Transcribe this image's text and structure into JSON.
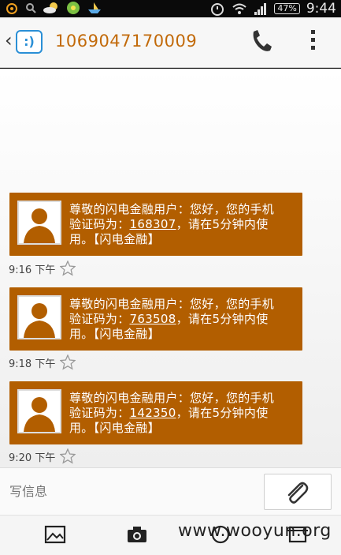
{
  "status_bar": {
    "battery": "47%",
    "time": "9:44"
  },
  "header": {
    "title": "1069047170009"
  },
  "messages": [
    {
      "line1": "尊敬的闪电金融用户：您好，您的手机",
      "line2_prefix": "验证码为：",
      "code": "168307",
      "line2_suffix": "，请在5分钟内使",
      "line3": "用。【闪电金融】",
      "time": "9:16 下午"
    },
    {
      "line1": "尊敬的闪电金融用户：您好，您的手机",
      "line2_prefix": "验证码为：",
      "code": "763508",
      "line2_suffix": "，请在5分钟内使",
      "line3": "用。【闪电金融】",
      "time": "9:18 下午"
    },
    {
      "line1": "尊敬的闪电金融用户：您好，您的手机",
      "line2_prefix": "验证码为：",
      "code": "142350",
      "line2_suffix": "，请在5分钟内使",
      "line3": "用。【闪电金融】",
      "time": "9:20 下午"
    }
  ],
  "compose": {
    "placeholder": "写信息"
  },
  "watermark": "www.wooyun.org",
  "colors": {
    "bubble": "#b25e00",
    "title": "#c26a0a",
    "app_icon": "#2a8fd6"
  },
  "icons": {
    "back": "chevron-left-icon",
    "app": "message-app-icon",
    "call": "phone-icon",
    "menu": "overflow-menu-icon",
    "star": "star-outline-icon",
    "attach": "paperclip-icon",
    "gallery": "picture-icon",
    "camera": "camera-icon"
  }
}
